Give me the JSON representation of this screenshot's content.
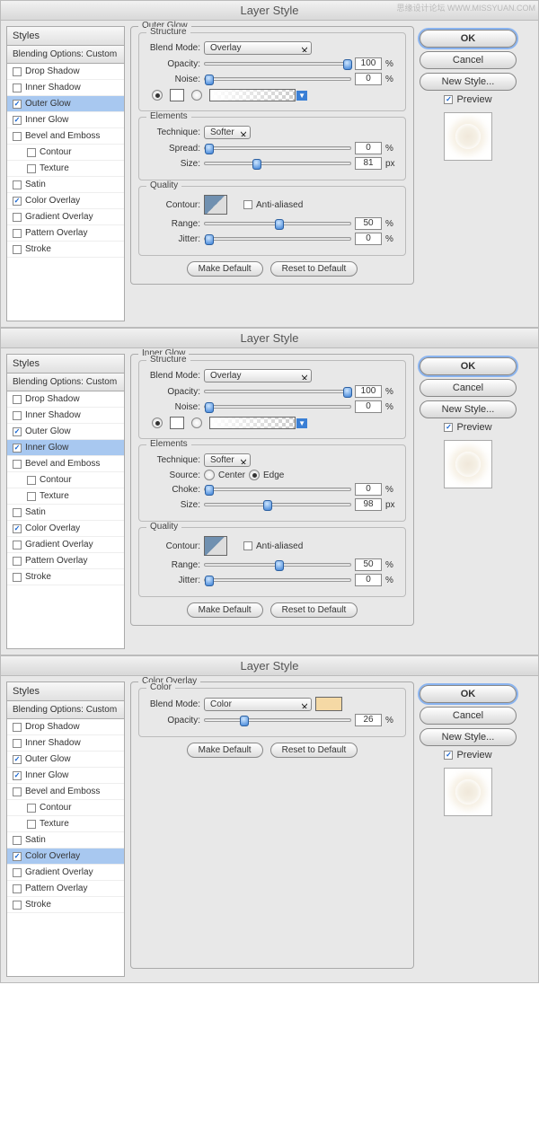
{
  "watermark": "思缘设计论坛  WWW.MISSYUAN.COM",
  "dialog_title": "Layer Style",
  "styles_header": "Styles",
  "blend_options": "Blending Options: Custom",
  "style_list": [
    {
      "label": "Drop Shadow",
      "checked": false
    },
    {
      "label": "Inner Shadow",
      "checked": false
    },
    {
      "label": "Outer Glow",
      "checked": true
    },
    {
      "label": "Inner Glow",
      "checked": true
    },
    {
      "label": "Bevel and Emboss",
      "checked": false
    },
    {
      "label": "Contour",
      "checked": false,
      "sub": true
    },
    {
      "label": "Texture",
      "checked": false,
      "sub": true
    },
    {
      "label": "Satin",
      "checked": false
    },
    {
      "label": "Color Overlay",
      "checked": true
    },
    {
      "label": "Gradient Overlay",
      "checked": false
    },
    {
      "label": "Pattern Overlay",
      "checked": false
    },
    {
      "label": "Stroke",
      "checked": false
    }
  ],
  "btn_ok": "OK",
  "btn_cancel": "Cancel",
  "btn_newstyle": "New Style...",
  "preview_label": "Preview",
  "btn_make_default": "Make Default",
  "btn_reset_default": "Reset to Default",
  "labels": {
    "structure": "Structure",
    "elements": "Elements",
    "quality": "Quality",
    "color": "Color",
    "blend_mode": "Blend Mode:",
    "opacity": "Opacity:",
    "noise": "Noise:",
    "technique": "Technique:",
    "spread": "Spread:",
    "size": "Size:",
    "choke": "Choke:",
    "source": "Source:",
    "center": "Center",
    "edge": "Edge",
    "contour": "Contour:",
    "anti": "Anti-aliased",
    "range": "Range:",
    "jitter": "Jitter:",
    "pct": "%",
    "px": "px"
  },
  "panel1": {
    "title": "Outer Glow",
    "selected": "Outer Glow",
    "blend_mode": "Overlay",
    "opacity": "100",
    "noise": "0",
    "technique": "Softer",
    "spread": "0",
    "size": "81",
    "range": "50",
    "jitter": "0",
    "anti": false,
    "fillmode": "gradient"
  },
  "panel2": {
    "title": "Inner Glow",
    "selected": "Inner Glow",
    "blend_mode": "Overlay",
    "opacity": "100",
    "noise": "0",
    "technique": "Softer",
    "source": "Edge",
    "choke": "0",
    "size": "98",
    "range": "50",
    "jitter": "0",
    "anti": false,
    "fillmode": "gradient"
  },
  "panel3": {
    "title": "Color Overlay",
    "selected": "Color Overlay",
    "blend_mode": "Color",
    "opacity": "26",
    "color": "#f5d9a5"
  }
}
